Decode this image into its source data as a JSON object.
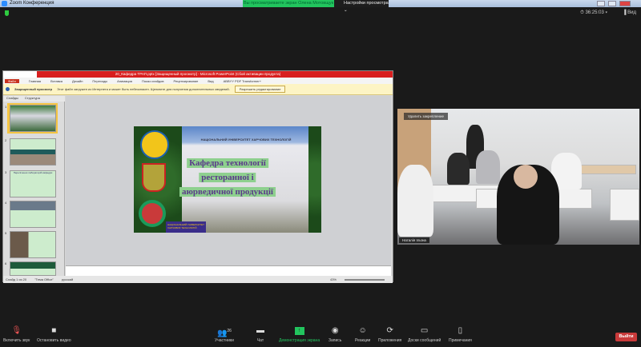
{
  "window": {
    "title": "Zoom Конференция"
  },
  "banner": {
    "text": "Вы просматриваете экран Олена Мотовщук",
    "view_options": "Настройки просмотра ⌄"
  },
  "top": {
    "timer": "⏱ 36:25:03 ▾",
    "view": "▐ Вид"
  },
  "ppt": {
    "title": "20_Кафедра ТРАП.pptx [Защищенный просмотр] - Microsoft PowerPoint (Сбой активации продукта)",
    "tabs": [
      "Файл",
      "Главная",
      "Вставка",
      "Дизайн",
      "Переходы",
      "Анимация",
      "Показ слайдов",
      "Рецензирование",
      "Вид",
      "ABBYY PDF Transformer+"
    ],
    "message": {
      "label": "Защищенный просмотр",
      "text": "Этот файл загружен из Интернета и может быть небезопасен. Щелкните для получения дополнительных сведений.",
      "button": "Разрешить редактирование"
    },
    "panel_tabs": [
      "Слайды",
      "Структура"
    ],
    "thumbnails": [
      "1",
      "2",
      "3",
      "4",
      "5",
      "6"
    ],
    "thumb3_title": "Перелічення лабораторій кафедри",
    "status": [
      "Слайд 1 из 20",
      "\"Тема Office\"",
      "русский"
    ],
    "zoom": "43%",
    "slide": {
      "building_sign": "НАЦІОНАЛЬНИЙ УНІВЕРСИТЕТ ХАРЧОВИХ ТЕХНОЛОГІЙ",
      "title_lines": [
        "Кафедра технології",
        "ресторанної і",
        "аюрведичної продукції"
      ],
      "plate": "НАЦІОНАЛЬНИЙ УНІВЕРСИТЕТ ХАРЧОВИХ ТЕХНОЛОГІЙ"
    }
  },
  "video": {
    "label": "Удалить закрепление",
    "name": "Наталія Ільїна"
  },
  "toolbar": {
    "items": [
      "Включить звук",
      "Остановить видео",
      "Участники",
      "Чат",
      "Демонстрация экрана",
      "Запись",
      "Реакции",
      "Приложения",
      "Доски сообщений",
      "Примечания"
    ],
    "participants_count": "26",
    "leave": "Выйти"
  },
  "colors": {
    "share_green": "#22c55e",
    "leave_red": "#c93a3a",
    "ppt_red": "#d81e1e"
  }
}
